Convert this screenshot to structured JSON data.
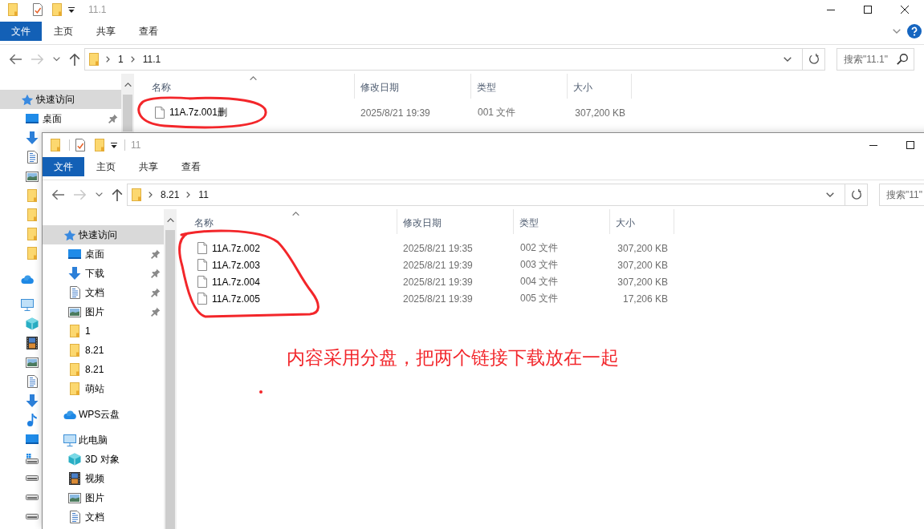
{
  "windows": [
    {
      "title": "11.1",
      "caption_buttons": [
        {
          "kind": "minimize"
        },
        {
          "kind": "maximize"
        },
        {
          "kind": "close"
        }
      ],
      "ribbon_tabs": [
        {
          "label": "文件",
          "kind": "menu"
        },
        {
          "label": "主页",
          "kind": "tab"
        },
        {
          "label": "共享",
          "kind": "tab"
        },
        {
          "label": "查看",
          "kind": "tab"
        }
      ],
      "ribbon_buttons": [
        {
          "kind": "expand"
        },
        {
          "kind": "help"
        }
      ],
      "nav_buttons": [
        {
          "kind": "back",
          "disabled": false
        },
        {
          "kind": "forward",
          "disabled": true
        },
        {
          "kind": "recent",
          "disabled": false
        },
        {
          "kind": "up",
          "disabled": false
        }
      ],
      "address": [
        "1",
        "11.1"
      ],
      "search": {
        "placeholder": "搜索\"11.1\""
      },
      "nav": [
        {
          "label": "快速访问",
          "kind": "star",
          "selected": true,
          "children": [
            {
              "label": "桌面",
              "kind": "desktop",
              "selected": false,
              "pinned": true
            },
            {
              "kind": "downloads"
            },
            {
              "kind": "documents"
            },
            {
              "kind": "pictures"
            },
            {
              "kind": "folder"
            },
            {
              "kind": "folder"
            },
            {
              "kind": "folder"
            },
            {
              "kind": "folder"
            }
          ]
        },
        {
          "kind": "cloud"
        },
        {
          "kind": "computer",
          "children": [
            {
              "kind": "objects"
            },
            {
              "kind": "videos"
            },
            {
              "kind": "pictures"
            },
            {
              "kind": "documents"
            },
            {
              "kind": "downloads"
            },
            {
              "kind": "music"
            },
            {
              "kind": "desktop"
            },
            {
              "kind": "systemdrive"
            },
            {
              "kind": "drive"
            },
            {
              "kind": "drive"
            },
            {
              "kind": "drive"
            }
          ]
        }
      ],
      "columns": [
        {
          "label": "名称",
          "sorted": true
        },
        {
          "label": "修改日期",
          "sorted": false
        },
        {
          "label": "类型",
          "sorted": false
        },
        {
          "label": "大小",
          "sorted": false
        }
      ],
      "files": [
        {
          "name": "11A.7z.001删",
          "modified": "2025/8/21 19:39",
          "type": "001 文件",
          "size": "307,200 KB"
        }
      ]
    },
    {
      "title": "11",
      "caption_buttons": [
        {
          "kind": "minimize"
        },
        {
          "kind": "maximize"
        }
      ],
      "ribbon_tabs": [
        {
          "label": "文件",
          "kind": "menu"
        },
        {
          "label": "主页",
          "kind": "tab"
        },
        {
          "label": "共享",
          "kind": "tab"
        },
        {
          "label": "查看",
          "kind": "tab"
        }
      ],
      "nav_buttons": [
        {
          "kind": "back",
          "disabled": false
        },
        {
          "kind": "forward",
          "disabled": true
        },
        {
          "kind": "recent",
          "disabled": false
        },
        {
          "kind": "up",
          "disabled": false
        }
      ],
      "address": [
        "8.21",
        "11"
      ],
      "search": {
        "placeholder": "搜索\"11\""
      },
      "nav": [
        {
          "label": "快速访问",
          "kind": "star",
          "selected": true,
          "children": [
            {
              "label": "桌面",
              "kind": "desktop",
              "selected": false,
              "pinned": true
            },
            {
              "label": "下载",
              "kind": "downloads",
              "selected": false,
              "pinned": true
            },
            {
              "label": "文档",
              "kind": "documents",
              "selected": false,
              "pinned": true
            },
            {
              "label": "图片",
              "kind": "pictures",
              "selected": false,
              "pinned": true
            },
            {
              "label": "1",
              "kind": "folder",
              "selected": false,
              "pinned": false
            },
            {
              "label": "8.21",
              "kind": "folder",
              "selected": false,
              "pinned": false
            },
            {
              "label": "8.21",
              "kind": "folder",
              "selected": false,
              "pinned": false
            },
            {
              "label": "萌站",
              "kind": "folder",
              "selected": false,
              "pinned": false
            }
          ]
        },
        {
          "label": "WPS云盘",
          "kind": "cloud",
          "selected": false
        },
        {
          "label": "此电脑",
          "kind": "computer",
          "selected": false,
          "children": [
            {
              "label": "3D 对象",
              "kind": "objects",
              "selected": false
            },
            {
              "label": "视频",
              "kind": "videos",
              "selected": false
            },
            {
              "label": "图片",
              "kind": "pictures",
              "selected": false
            },
            {
              "label": "文档",
              "kind": "documents",
              "selected": false
            }
          ]
        }
      ],
      "columns": [
        {
          "label": "名称",
          "sorted": true
        },
        {
          "label": "修改日期",
          "sorted": false
        },
        {
          "label": "类型",
          "sorted": false
        },
        {
          "label": "大小",
          "sorted": false
        }
      ],
      "files": [
        {
          "name": "11A.7z.002",
          "modified": "2025/8/21 19:35",
          "type": "002 文件",
          "size": "307,200 KB"
        },
        {
          "name": "11A.7z.003",
          "modified": "2025/8/21 19:39",
          "type": "003 文件",
          "size": "307,200 KB"
        },
        {
          "name": "11A.7z.004",
          "modified": "2025/8/21 19:39",
          "type": "004 文件",
          "size": "307,200 KB"
        },
        {
          "name": "11A.7z.005",
          "modified": "2025/8/21 19:39",
          "type": "005 文件",
          "size": "17,206 KB"
        }
      ],
      "annotation": {
        "text": "内容采用分盘，把两个链接下载放在一起"
      }
    }
  ]
}
